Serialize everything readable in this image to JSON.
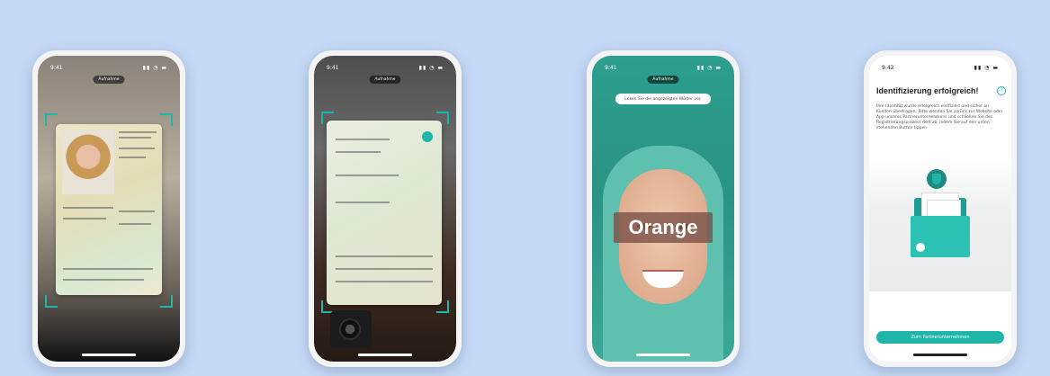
{
  "status": {
    "time_1": "9:41",
    "time_2": "9:41",
    "time_3": "9:41",
    "time_4": "9:42"
  },
  "recording_pill": "Aufnahme",
  "phone1": {},
  "phone2": {},
  "phone3": {
    "instruction": "Lesen Sie die angezeigten Wörter vor.",
    "spoken_word": "Orange"
  },
  "phone4": {
    "title": "Identifizierung erfolgreich!",
    "body": "Ihre Identität wurde erfolgreich verifiziert und sicher an Kunden übertragen. Bitte wenden Sie zurück zur Website oder App unseres Partnerunternehmens und schließen Sie den Registrierungsprozess dort ab, indem Sie auf den unten stehenden Button tippen.",
    "cta_label": "Zum Partnerunternehmen"
  },
  "colors": {
    "background": "#c5d9f6",
    "accent": "#1fb5a8"
  }
}
